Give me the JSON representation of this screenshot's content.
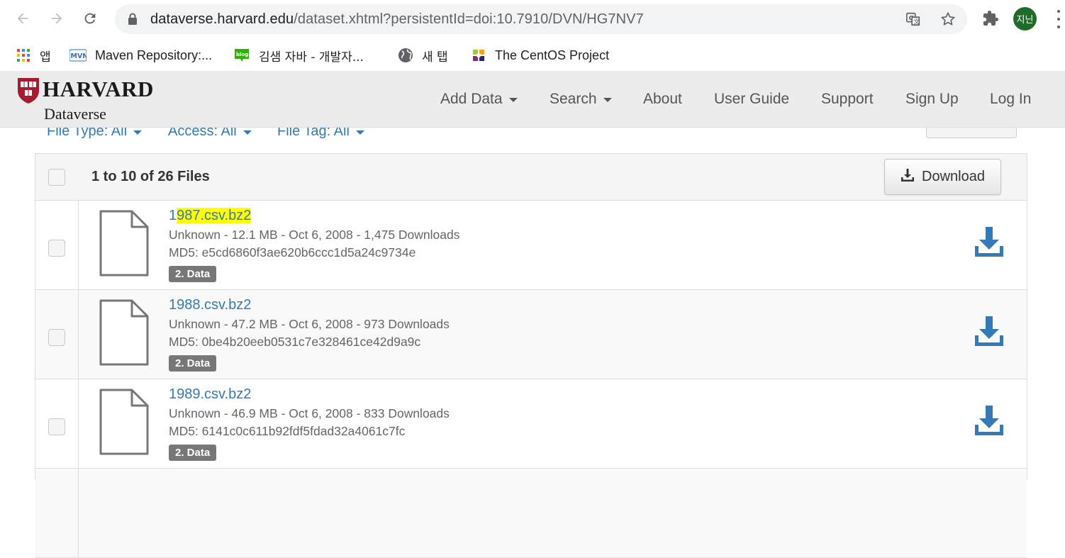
{
  "browser": {
    "url_domain": "dataverse.harvard.edu",
    "url_path": "/dataset.xhtml?persistentId=doi:10.7910/DVN/HG7NV7",
    "profile_initials": "지닌"
  },
  "bookmarks": [
    {
      "label": "앱",
      "icon": "apps-grid-icon"
    },
    {
      "label": "Maven Repository:...",
      "icon": "mvn-icon"
    },
    {
      "label": "김샘 자바 - 개발자...",
      "icon": "blog-icon"
    },
    {
      "label": "새 탭",
      "icon": "globe-icon"
    },
    {
      "label": "The CentOS Project",
      "icon": "centos-icon"
    }
  ],
  "site": {
    "logo_title": "HARVARD",
    "logo_subtitle": "Dataverse",
    "nav": {
      "add_data": "Add Data",
      "search": "Search",
      "about": "About",
      "user_guide": "User Guide",
      "support": "Support",
      "sign_up": "Sign Up",
      "log_in": "Log In"
    }
  },
  "filters": {
    "file_type": "File Type: All",
    "access": "Access: All",
    "file_tag": "File Tag: All"
  },
  "files_table": {
    "header_label": "1 to 10 of 26 Files",
    "download_label": "Download",
    "rows": [
      {
        "name_first": "1",
        "name_highlighted": "987.csv.bz2",
        "info": "Unknown - 12.1 MB - Oct 6, 2008 - 1,475 Downloads",
        "md5": "MD5: e5cd6860f3ae620b6ccc1d5a24c9734e",
        "tag": "2. Data"
      },
      {
        "name": "1988.csv.bz2",
        "info": "Unknown - 47.2 MB - Oct 6, 2008 - 973 Downloads",
        "md5": "MD5: 0be4b20eeb0531c7e328461ce42d9a9c",
        "tag": "2. Data"
      },
      {
        "name": "1989.csv.bz2",
        "info": "Unknown - 46.9 MB - Oct 6, 2008 - 833 Downloads",
        "md5": "MD5: 6141c0c611b92fdf5fdad32a4061c7fc",
        "tag": "2. Data"
      }
    ]
  },
  "colors": {
    "link": "#337ab7",
    "highlight": "#ffff00",
    "badge": "#777777"
  }
}
